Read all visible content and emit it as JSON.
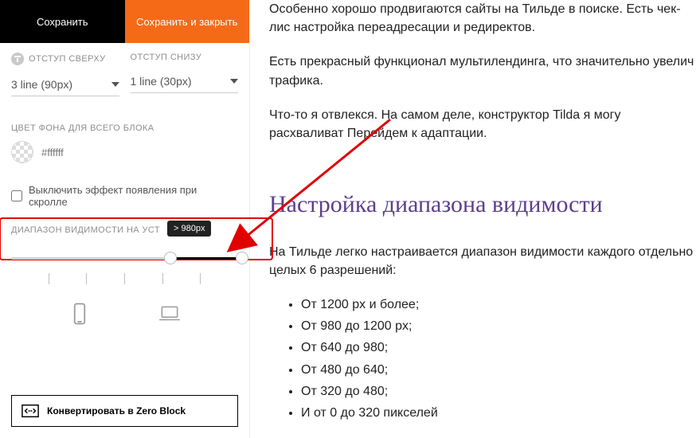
{
  "tabs": {
    "save": "Сохранить",
    "saveclose": "Сохранить и закрыть"
  },
  "padding": {
    "top_label": "ОТСТУП СВЕРХУ",
    "bottom_label": "ОТСТУП СНИЗУ",
    "top_value": "3 line (90px)",
    "bottom_value": "1 line (30px)"
  },
  "bg": {
    "label": "ЦВЕТ ФОНА ДЛЯ ВСЕГО БЛОКА",
    "placeholder": "#ffffff"
  },
  "scroll_effect": "Выключить эффект появления при скролле",
  "visibility": {
    "label": "ДИАПАЗОН ВИДИМОСТИ НА УСТ",
    "tooltip": "> 980px"
  },
  "convert": "Конвертировать в Zero Block",
  "article": {
    "p1": "Особенно хорошо продвигаются сайты на Тильде в поиске. Есть чек-лис настройка переадресации и редиректов.",
    "p2": "Есть прекрасный функционал мультилендинга, что значительно увелич трафика.",
    "p3": "Что-то я отвлекся. На самом деле, конструктор Tilda я могу расхваливат Перейдем к адаптации.",
    "h": "Настройка диапазона видимости",
    "p4": "На Тильде легко настраивается диапазон видимости каждого отдельно целых 6 разрешений:",
    "list": [
      "От 1200 px и более;",
      "От 980 до 1200 px;",
      "От 640 до 980;",
      "От 480 до 640;",
      "От 320 до 480;",
      "И от 0 до 320 пикселей"
    ]
  }
}
